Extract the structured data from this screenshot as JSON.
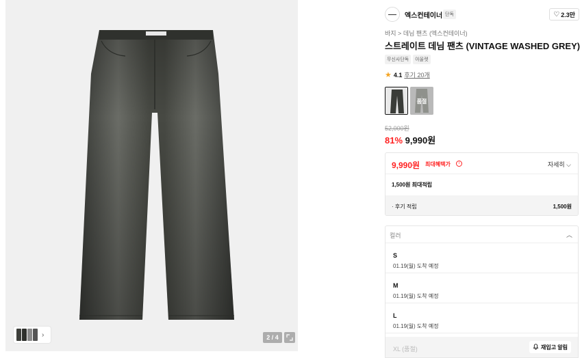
{
  "gallery": {
    "counter": "2 / 4",
    "expand_icon": "expand-icon",
    "thumb_chevron": "›"
  },
  "brand": {
    "name": "엑스컨테이너",
    "badge": "단독",
    "likes": "2.3만",
    "like_icon": "heart-icon"
  },
  "product": {
    "breadcrumb": "바지 > 데님 팬츠 (엑스컨테이너)",
    "title": "스트레이트 데님 팬츠 (VINTAGE WASHED GREY)",
    "tags": [
      "무신사단독",
      "아울렛"
    ],
    "rating": "4.1",
    "reviews": "후기 20개",
    "swatches": [
      {
        "label": "",
        "selected": true
      },
      {
        "label": "품절",
        "selected": false
      }
    ]
  },
  "price": {
    "original": "52,000원",
    "discount": "81%",
    "current": "9,990원"
  },
  "benefit": {
    "max_price": "9,990원",
    "max_label": "최대혜택가",
    "info_icon": "ⓘ",
    "detail_label": "자세히",
    "points": "1,500원 최대적립",
    "review_label": "· 후기 적립",
    "review_value": "1,500원"
  },
  "options": {
    "header": "컬러",
    "items": [
      {
        "size": "S",
        "eta": "01.19(월) 도착 예정"
      },
      {
        "size": "M",
        "eta": "01.19(월) 도착 예정"
      },
      {
        "size": "L",
        "eta": "01.19(월) 도착 예정"
      }
    ],
    "soldout": {
      "label": "XL (품절)",
      "button": "재입고 알림",
      "bell_icon": "bell-icon"
    }
  },
  "colors": {
    "accent_red": "#ff2222",
    "star": "#f5a524"
  }
}
